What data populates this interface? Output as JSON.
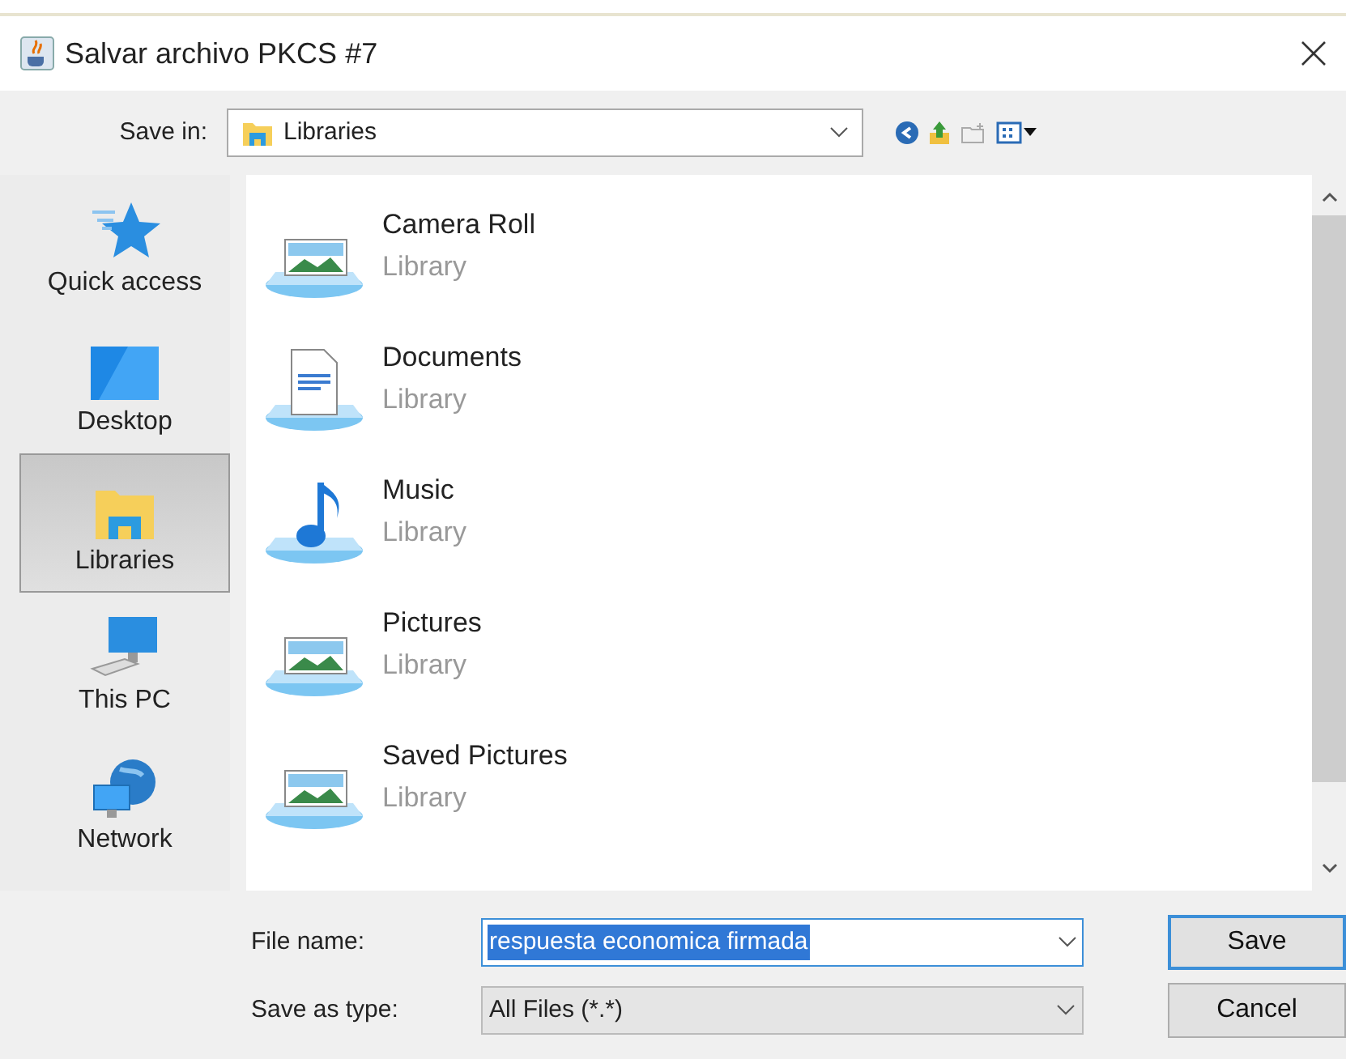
{
  "window": {
    "title": "Salvar archivo PKCS #7"
  },
  "save_in": {
    "label": "Save in:",
    "value": "Libraries"
  },
  "sidebar": {
    "items": [
      {
        "label": "Quick access",
        "kind": "star",
        "selected": false
      },
      {
        "label": "Desktop",
        "kind": "desktop",
        "selected": false
      },
      {
        "label": "Libraries",
        "kind": "folder",
        "selected": true
      },
      {
        "label": "This PC",
        "kind": "pc",
        "selected": false
      },
      {
        "label": "Network",
        "kind": "network",
        "selected": false
      }
    ]
  },
  "files": [
    {
      "name": "Camera Roll",
      "type": "Library",
      "kind": "pictures"
    },
    {
      "name": "Documents",
      "type": "Library",
      "kind": "documents"
    },
    {
      "name": "Music",
      "type": "Library",
      "kind": "music"
    },
    {
      "name": "Pictures",
      "type": "Library",
      "kind": "pictures"
    },
    {
      "name": "Saved Pictures",
      "type": "Library",
      "kind": "pictures"
    }
  ],
  "file_name": {
    "label": "File name:",
    "value": "respuesta economica firmada"
  },
  "save_as_type": {
    "label": "Save as type:",
    "value": "All Files (*.*)"
  },
  "buttons": [
    "Save",
    "Cancel"
  ]
}
